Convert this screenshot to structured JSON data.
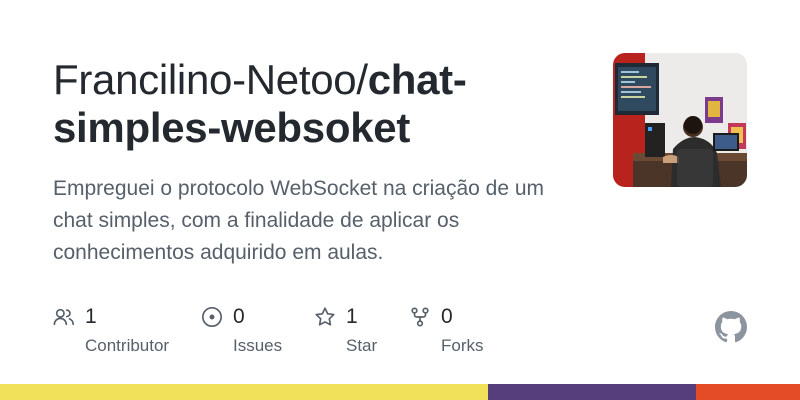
{
  "repo": {
    "owner": "Francilino-Netoo/",
    "name": "chat-simples-websoket",
    "description": "Empreguei o protocolo WebSocket na criação de um chat simples, com a finalidade de aplicar os conhecimentos adquirido em aulas."
  },
  "stats": [
    {
      "icon": "people-icon",
      "value": "1",
      "label": "Contributor"
    },
    {
      "icon": "issue-icon",
      "value": "0",
      "label": "Issues"
    },
    {
      "icon": "star-icon",
      "value": "1",
      "label": "Star"
    },
    {
      "icon": "fork-icon",
      "value": "0",
      "label": "Forks"
    }
  ],
  "logo": {
    "icon": "github-logo-icon"
  },
  "language_bar": {
    "segments": [
      {
        "color": "#f1e05a",
        "fraction": 0.61
      },
      {
        "color": "#563d7c",
        "fraction": 0.26
      },
      {
        "color": "#e34c26",
        "fraction": 0.13
      }
    ]
  }
}
